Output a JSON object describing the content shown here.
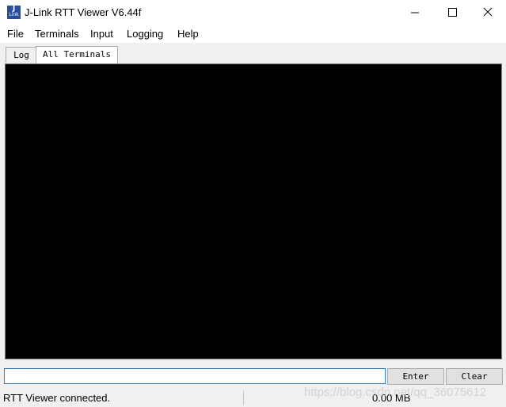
{
  "window": {
    "title": "J-Link RTT Viewer V6.44f",
    "icon": {
      "name": "jlink-logo-icon",
      "top": "J",
      "bottom": "Link"
    },
    "controls": [
      "minimize-icon",
      "maximize-icon",
      "close-icon"
    ]
  },
  "menu": {
    "file": "File",
    "terminals": "Terminals",
    "input": "Input",
    "logging": "Logging",
    "help": "Help"
  },
  "tabs": [
    {
      "label": "Log",
      "active": false
    },
    {
      "label": "All Terminals",
      "active": true
    }
  ],
  "terminal": {
    "background": "#000000"
  },
  "input_row": {
    "value": "",
    "enter_label": "Enter",
    "clear_label": "Clear"
  },
  "status": {
    "message": "RTT Viewer connected.",
    "data_size": "0.00 MB"
  },
  "watermark": "https://blog.csdn.net/qq_36075612",
  "colors": {
    "accent_border": "#3c7fb1",
    "icon_blue": "#2a4d9b"
  }
}
